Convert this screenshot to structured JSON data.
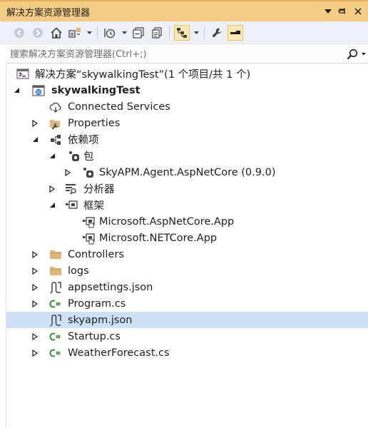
{
  "window": {
    "title": "解决方案资源管理器"
  },
  "search": {
    "placeholder": "搜索解决方案资源管理器(Ctrl+;)"
  },
  "tree": {
    "items": [
      {
        "label": "解决方案“skywalkingTest”(1 个项目/共 1 个)",
        "icon": "solution-icon"
      },
      {
        "label": "skywalkingTest",
        "icon": "web-project-icon"
      },
      {
        "label": "Connected Services",
        "icon": "connected-services-icon"
      },
      {
        "label": "Properties",
        "icon": "properties-folder-icon"
      },
      {
        "label": "依赖项",
        "icon": "dependencies-icon"
      },
      {
        "label": "包",
        "icon": "package-icon"
      },
      {
        "label": "SkyAPM.Agent.AspNetCore (0.9.0)",
        "icon": "package-icon"
      },
      {
        "label": "分析器",
        "icon": "analyzer-icon"
      },
      {
        "label": "框架",
        "icon": "framework-icon"
      },
      {
        "label": "Microsoft.AspNetCore.App",
        "icon": "framework-reference-icon"
      },
      {
        "label": "Microsoft.NETCore.App",
        "icon": "framework-reference-icon"
      },
      {
        "label": "Controllers",
        "icon": "folder-icon"
      },
      {
        "label": "logs",
        "icon": "folder-icon"
      },
      {
        "label": "appsettings.json",
        "icon": "json-file-icon"
      },
      {
        "label": "Program.cs",
        "icon": "csharp-file-icon"
      },
      {
        "label": "skyapm.json",
        "icon": "json-file-icon"
      },
      {
        "label": "Startup.cs",
        "icon": "csharp-file-icon"
      },
      {
        "label": "WeatherForecast.cs",
        "icon": "csharp-file-icon"
      }
    ],
    "selected_label": "skyapm.json"
  },
  "colors": {
    "title_bar": "#f5cc84",
    "toolbar": "#eef0f8",
    "selection": "#cce1f6",
    "folder": "#dcb67a",
    "csharp": "#388a34",
    "accent_purple": "#68217a"
  }
}
